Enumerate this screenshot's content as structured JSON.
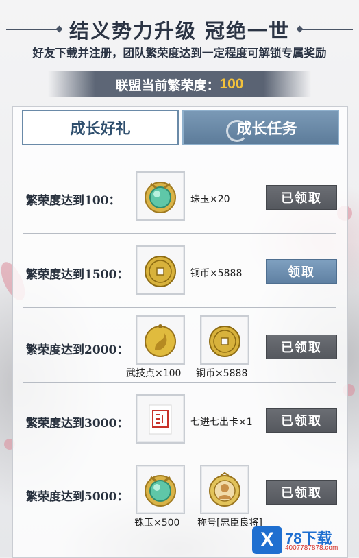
{
  "header": {
    "title": "结义势力升级 冠绝一世",
    "subtitle": "好友下载并注册，团队繁荣度达到一定程度可解锁专属奖励"
  },
  "prosperity": {
    "label": "联盟当前繁荣度：",
    "value": "100",
    "value_color": "#f3c23b"
  },
  "tabs": [
    {
      "label": "成长好礼",
      "active": false
    },
    {
      "label": "成长任务",
      "active": true
    }
  ],
  "tasks": [
    {
      "requirement": "繁荣度达到100：",
      "rewards": [
        {
          "icon": "jade-pearl-icon",
          "name": "珠玉×20"
        }
      ],
      "button": "已领取",
      "state": "claimed"
    },
    {
      "requirement": "繁荣度达到1500：",
      "rewards": [
        {
          "icon": "copper-coin-icon",
          "name": "铜币×5888"
        }
      ],
      "button": "领取",
      "state": "claimable"
    },
    {
      "requirement": "繁荣度达到2000：",
      "rewards": [
        {
          "icon": "martial-token-icon",
          "name": "武技点×100"
        },
        {
          "icon": "copper-coin-icon",
          "name": "铜币×5888"
        }
      ],
      "button": "已领取",
      "state": "claimed"
    },
    {
      "requirement": "繁荣度达到3000：",
      "rewards": [
        {
          "icon": "seal-card-icon",
          "name": "七进七出卡×1"
        }
      ],
      "button": "已领取",
      "state": "claimed"
    },
    {
      "requirement": "繁荣度达到5000：",
      "rewards": [
        {
          "icon": "jade-pearl-icon",
          "name": "铢玉×500"
        },
        {
          "icon": "loyal-minister-title-icon",
          "name": "称号[忠臣良将]"
        }
      ],
      "button": "已领取",
      "state": "claimed"
    }
  ],
  "watermark": {
    "mark": "X",
    "text": "78下载",
    "url": "4007787878.com"
  }
}
